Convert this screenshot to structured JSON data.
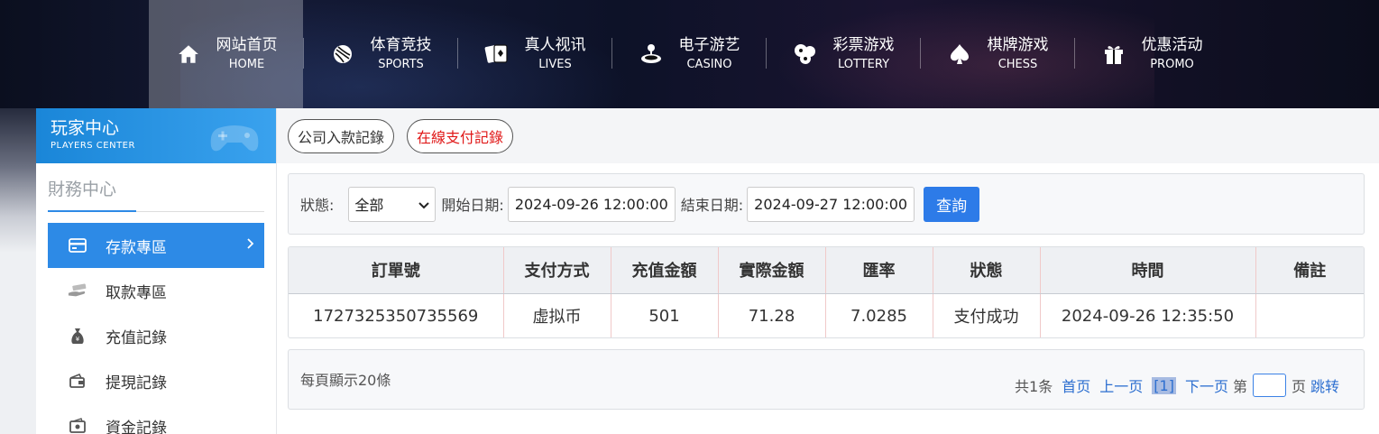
{
  "nav": [
    {
      "zh": "网站首页",
      "en": "HOME",
      "icon": "home-icon",
      "active": true
    },
    {
      "zh": "体育竞技",
      "en": "SPORTS",
      "icon": "ball-icon",
      "active": false
    },
    {
      "zh": "真人视讯",
      "en": "LIVES",
      "icon": "cards-icon",
      "active": false
    },
    {
      "zh": "电子游艺",
      "en": "CASINO",
      "icon": "joystick-icon",
      "active": false
    },
    {
      "zh": "彩票游戏",
      "en": "LOTTERY",
      "icon": "lottery-balls-icon",
      "active": false
    },
    {
      "zh": "棋牌游戏",
      "en": "CHESS",
      "icon": "spade-icon",
      "active": false
    },
    {
      "zh": "优惠活动",
      "en": "PROMO",
      "icon": "gift-icon",
      "active": false
    }
  ],
  "sidebar": {
    "title": "玩家中心",
    "subtitle": "PLAYERS CENTER",
    "section": "財務中心",
    "items": [
      {
        "label": "存款專區",
        "icon": "card-icon",
        "active": true
      },
      {
        "label": "取款專區",
        "icon": "cash-hand-icon",
        "active": false
      },
      {
        "label": "充值記錄",
        "icon": "money-bag-icon",
        "active": false
      },
      {
        "label": "提現記錄",
        "icon": "wallet-icon",
        "active": false
      },
      {
        "label": "資金記錄",
        "icon": "funds-icon",
        "active": false
      }
    ]
  },
  "tabs": [
    "公司入款記錄",
    "在線支付記錄"
  ],
  "filter": {
    "status_label": "狀態:",
    "status_value": "全部",
    "start_label": "開始日期:",
    "start_value": "2024-09-26 12:00:00",
    "end_label": "結束日期:",
    "end_value": "2024-09-27 12:00:00",
    "search_label": "查詢"
  },
  "table": {
    "headers": [
      "訂單號",
      "支付方式",
      "充值金額",
      "實際金額",
      "匯率",
      "狀態",
      "時間",
      "備註"
    ],
    "rows": [
      [
        "1727325350735569",
        "虚拟币",
        "501",
        "71.28",
        "7.0285",
        "支付成功",
        "2024-09-26 12:35:50",
        ""
      ]
    ]
  },
  "pager": {
    "per_page": "每頁顯示20條",
    "total": "共1条",
    "first": "首页",
    "prev": "上一页",
    "current": "[1]",
    "next": "下一页",
    "goto_prefix": "第",
    "goto_suffix": "页",
    "jump": "跳转"
  },
  "colors": {
    "accent": "#2d8ae6",
    "active_tab": "#e01818",
    "button": "#2d7be8"
  }
}
